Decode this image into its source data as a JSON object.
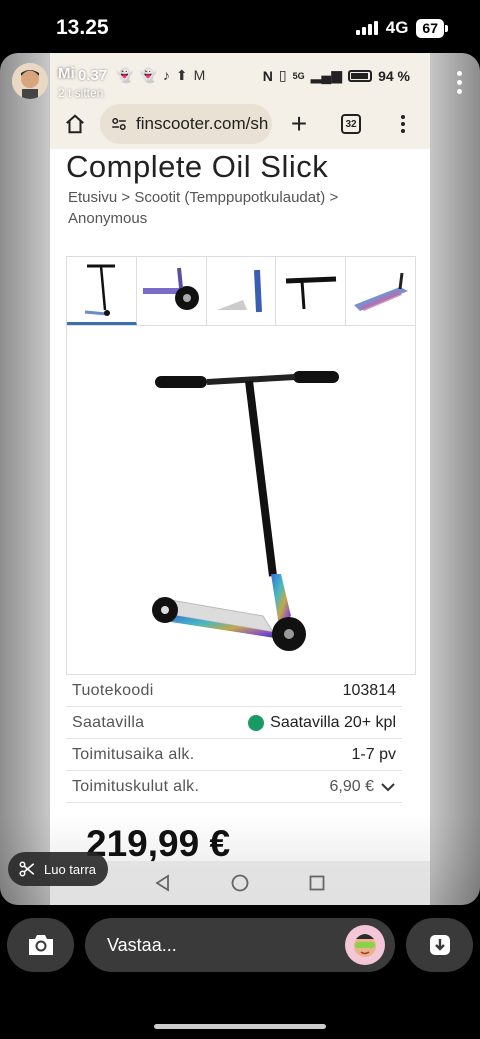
{
  "os_status": {
    "time": "13.25",
    "network": "4G",
    "battery": "67"
  },
  "story": {
    "user": "Mi",
    "time_ago": "2 t sitten",
    "sticker_button": "Luo tarra",
    "reply_placeholder": "Vastaa..."
  },
  "inner_status": {
    "time": "0.37",
    "battery_percent": "94 %",
    "net": "5G"
  },
  "browser": {
    "url": "finscooter.com/sh",
    "tab_count": "32"
  },
  "product": {
    "title": "Complete Oil Slick",
    "breadcrumb": [
      "Etusivu",
      "Scootit (Temppupotkulaudat)",
      "Anonymous"
    ],
    "breadcrumb_sep": ">",
    "price": "219,99 €",
    "rows": [
      {
        "label": "Tuotekoodi",
        "value": "103814"
      },
      {
        "label": "Saatavilla",
        "value": "Saatavilla 20+ kpl"
      },
      {
        "label": "Toimitusaika alk.",
        "value": "1-7 pv"
      },
      {
        "label": "Toimituskulut alk.",
        "value": "6,90 €"
      }
    ]
  },
  "colors": {
    "availability": "#1a9a63",
    "browser_chrome": "#f4efe7"
  }
}
